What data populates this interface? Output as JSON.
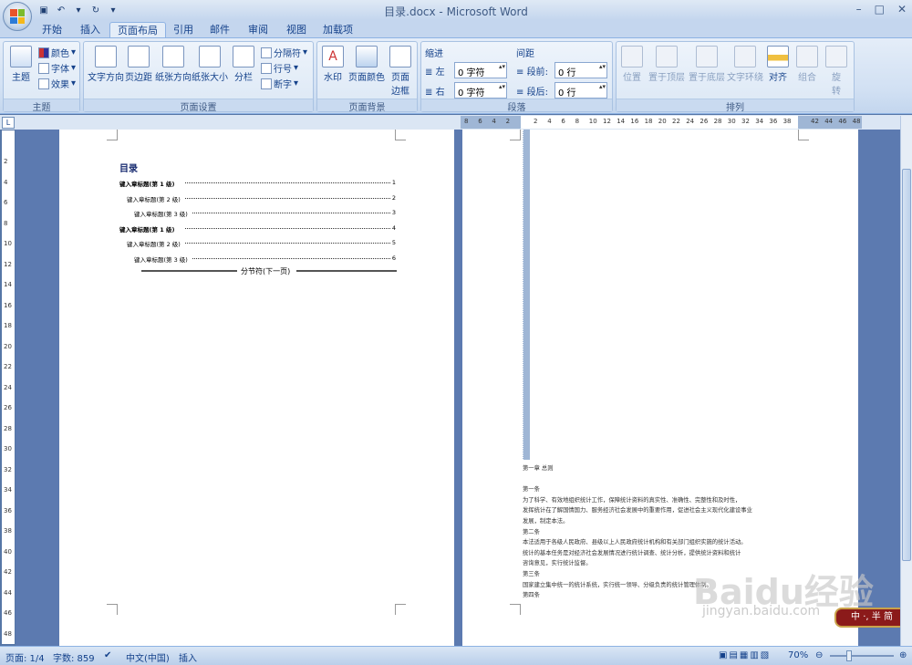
{
  "window": {
    "title": "目录.docx - Microsoft Word",
    "controls": [
      "–",
      "□",
      "✕"
    ]
  },
  "tabs": [
    "开始",
    "插入",
    "页面布局",
    "引用",
    "邮件",
    "审阅",
    "视图",
    "加载项"
  ],
  "active_tab": "页面布局",
  "ribbon": {
    "theme": {
      "label": "主题",
      "btn": "主题",
      "colors": "颜色",
      "fonts": "字体",
      "effects": "效果"
    },
    "page_setup": {
      "label": "页面设置",
      "direction": "文字方向",
      "margins": "页边距",
      "orientation": "纸张方向",
      "size": "纸张大小",
      "columns": "分栏",
      "breaks": "分隔符",
      "line_numbers": "行号",
      "hyphen": "断字"
    },
    "background": {
      "label": "页面背景",
      "watermark": "水印",
      "color": "页面颜色",
      "borders": "页面\n边框"
    },
    "paragraph": {
      "label": "段落",
      "indent": "缩进",
      "left_label": "左",
      "left_val": "0 字符",
      "right_label": "右",
      "right_val": "0 字符",
      "spacing": "间距",
      "before_label": "段前",
      "before_val": "0 行",
      "after_label": "段后",
      "after_val": "0 行"
    },
    "arrange": {
      "label": "排列",
      "position": "位置",
      "front": "置于顶层",
      "back": "置于底层",
      "wrap": "文字环绕",
      "align": "对齐",
      "group": "组合",
      "rotate": "旋\n转"
    }
  },
  "hruler_ticks": [
    "8",
    "6",
    "4",
    "2",
    "",
    "2",
    "4",
    "6",
    "8",
    "10",
    "12",
    "14",
    "16",
    "18",
    "20",
    "22",
    "24",
    "26",
    "28",
    "30",
    "32",
    "34",
    "36",
    "38",
    "",
    "42",
    "44",
    "46",
    "48"
  ],
  "vruler_ticks": [
    "2",
    "4",
    "6",
    "8",
    "10",
    "12",
    "14",
    "16",
    "18",
    "20",
    "22",
    "24",
    "26",
    "28",
    "30",
    "32",
    "34",
    "36",
    "38",
    "40",
    "42",
    "44",
    "46",
    "48"
  ],
  "doc": {
    "toc_title": "目录",
    "toc": [
      {
        "text": "键入章标题(第 1 级)",
        "page": "1",
        "level": 1
      },
      {
        "text": "键入章标题(第 2 级)",
        "page": "2",
        "level": 2
      },
      {
        "text": "键入章标题(第 3 级)",
        "page": "3",
        "level": 3
      },
      {
        "text": "键入章标题(第 1 级)",
        "page": "4",
        "level": 1
      },
      {
        "text": "键入章标题(第 2 级)",
        "page": "5",
        "level": 2
      },
      {
        "text": "键入章标题(第 3 级)",
        "page": "6",
        "level": 3
      }
    ],
    "section_break": "分节符(下一页)",
    "page2_lines": [
      "第一章  总则",
      "",
      "第一条",
      "    为了科学、有效地组织统计工作，保障统计资料的真实性、准确性、完整性和及时性，",
      "发挥统计在了解国情国力、服务经济社会发展中的重要作用，促进社会主义现代化建设事业",
      "发展，制定本法。",
      "第二条",
      "    本法适用于各级人民政府、县级以上人民政府统计机构和有关部门组织实施的统计活动。",
      "    统计的基本任务是对经济社会发展情况进行统计调查、统计分析，提供统计资料和统计",
      "咨询意见，实行统计监督。",
      "第三条",
      "    国家建立集中统一的统计系统，实行统一领导、分级负责的统计管理体制。",
      "第四条"
    ]
  },
  "status": {
    "page": "页面: 1/4",
    "words": "字数: 859",
    "lang": "中文(中国)",
    "mode": "插入",
    "zoom": "70%"
  },
  "watermark": {
    "text": "Baidu经验",
    "sub": "jingyan.baidu.com"
  },
  "ime": "中 ·, 半 简"
}
